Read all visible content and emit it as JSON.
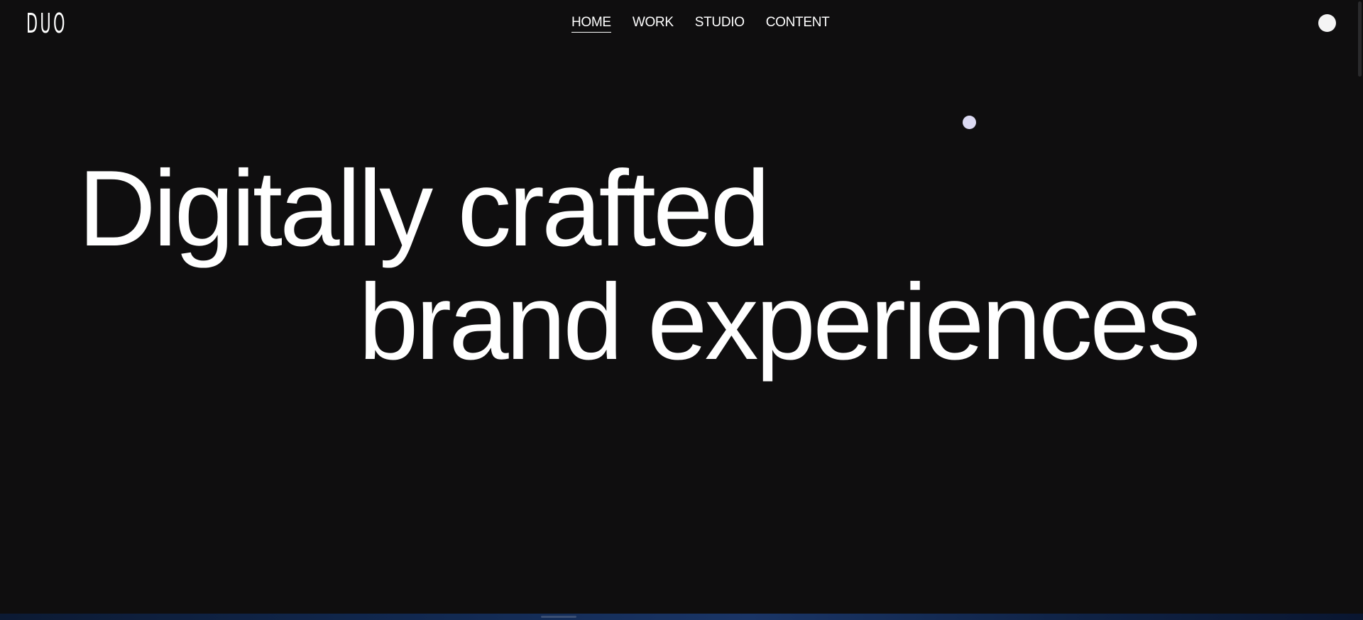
{
  "header": {
    "logo": "DUO",
    "nav": [
      {
        "label": "HOME",
        "active": true
      },
      {
        "label": "WORK",
        "active": false
      },
      {
        "label": "STUDIO",
        "active": false
      },
      {
        "label": "CONTENT",
        "active": false
      }
    ],
    "menu_icon": "menu-dot-icon"
  },
  "hero": {
    "line1": "Digitally crafted",
    "line2": "brand experiences"
  },
  "colors": {
    "background": "#0f0e0f",
    "text": "#ffffff",
    "cursor": "#dcdaf3"
  }
}
